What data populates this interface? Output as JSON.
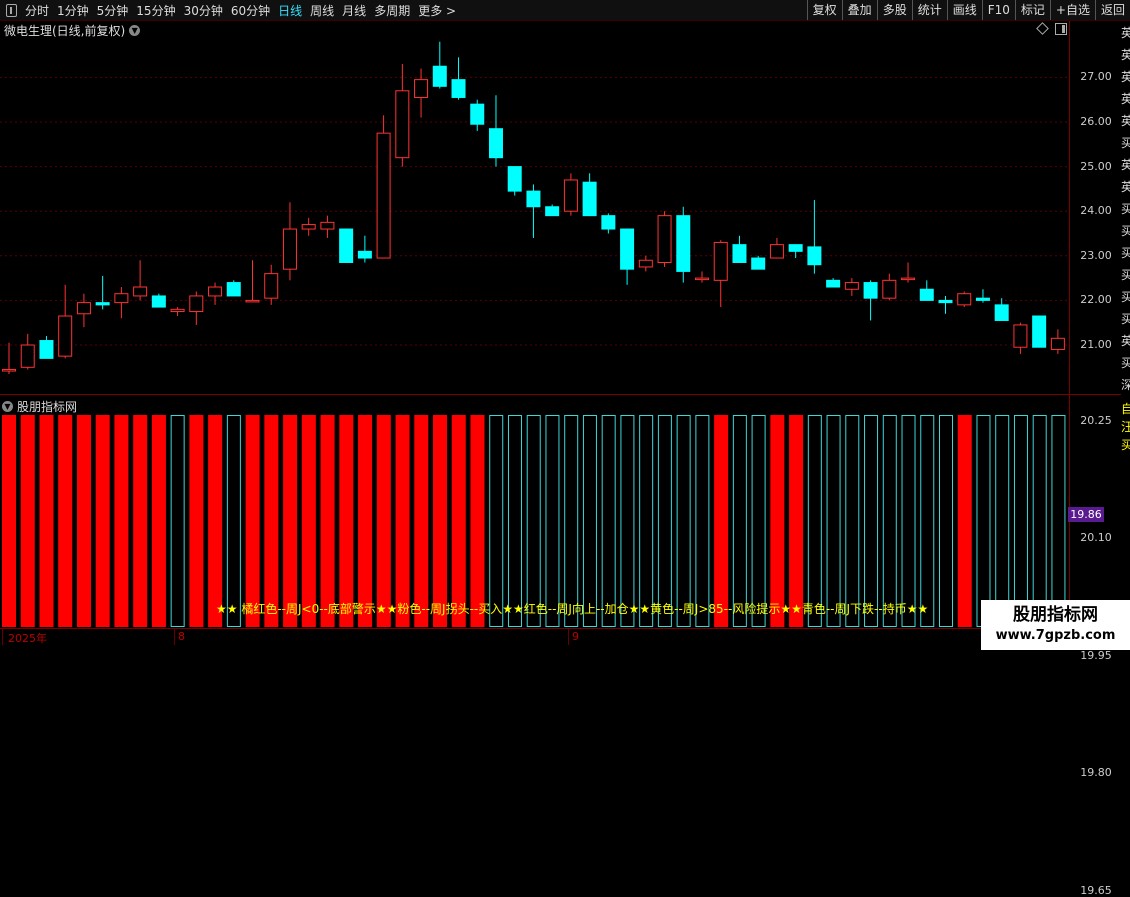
{
  "toolbar": {
    "periods": [
      "分时",
      "1分钟",
      "5分钟",
      "15分钟",
      "30分钟",
      "60分钟",
      "日线",
      "周线",
      "月线",
      "多周期",
      "更多 >"
    ],
    "active_period": "日线",
    "buttons": [
      "复权",
      "叠加",
      "多股",
      "统计",
      "画线",
      "F10",
      "标记",
      "+自选",
      "返回"
    ]
  },
  "main_chart": {
    "title": "微电生理(日线,前复权)",
    "y_ticks": [
      "27.00",
      "26.00",
      "25.00",
      "24.00",
      "23.00",
      "22.00",
      "21.00"
    ],
    "grid_line_color": "#5a0000",
    "up_color": "#ff3232",
    "down_color": "#00ffff",
    "candles": [
      {
        "o": 20.45,
        "h": 21.05,
        "l": 20.35,
        "c": 20.45
      },
      {
        "o": 20.5,
        "h": 21.25,
        "l": 20.45,
        "c": 21.0
      },
      {
        "o": 21.1,
        "h": 21.2,
        "l": 20.7,
        "c": 20.7
      },
      {
        "o": 20.75,
        "h": 22.35,
        "l": 20.7,
        "c": 21.65
      },
      {
        "o": 21.7,
        "h": 22.15,
        "l": 21.4,
        "c": 21.95
      },
      {
        "o": 21.95,
        "h": 22.55,
        "l": 21.8,
        "c": 21.9
      },
      {
        "o": 21.95,
        "h": 22.3,
        "l": 21.6,
        "c": 22.15
      },
      {
        "o": 22.1,
        "h": 22.9,
        "l": 22.0,
        "c": 22.3
      },
      {
        "o": 22.1,
        "h": 22.15,
        "l": 21.85,
        "c": 21.85
      },
      {
        "o": 21.75,
        "h": 21.85,
        "l": 21.65,
        "c": 21.8
      },
      {
        "o": 21.75,
        "h": 22.2,
        "l": 21.45,
        "c": 22.1
      },
      {
        "o": 22.1,
        "h": 22.4,
        "l": 21.9,
        "c": 22.3
      },
      {
        "o": 22.4,
        "h": 22.45,
        "l": 22.1,
        "c": 22.1
      },
      {
        "o": 22.0,
        "h": 22.9,
        "l": 22.0,
        "c": 22.0
      },
      {
        "o": 22.05,
        "h": 22.8,
        "l": 21.9,
        "c": 22.6
      },
      {
        "o": 22.7,
        "h": 24.2,
        "l": 22.45,
        "c": 23.6
      },
      {
        "o": 23.6,
        "h": 23.85,
        "l": 23.45,
        "c": 23.7
      },
      {
        "o": 23.6,
        "h": 23.9,
        "l": 23.4,
        "c": 23.75
      },
      {
        "o": 23.6,
        "h": 23.6,
        "l": 22.85,
        "c": 22.85
      },
      {
        "o": 23.1,
        "h": 23.45,
        "l": 22.85,
        "c": 22.95
      },
      {
        "o": 22.95,
        "h": 26.15,
        "l": 22.95,
        "c": 25.75
      },
      {
        "o": 25.2,
        "h": 27.3,
        "l": 25.0,
        "c": 26.7
      },
      {
        "o": 26.55,
        "h": 27.2,
        "l": 26.1,
        "c": 26.95
      },
      {
        "o": 27.25,
        "h": 27.8,
        "l": 26.75,
        "c": 26.8
      },
      {
        "o": 26.95,
        "h": 27.45,
        "l": 26.5,
        "c": 26.55
      },
      {
        "o": 26.4,
        "h": 26.5,
        "l": 25.8,
        "c": 25.95
      },
      {
        "o": 25.85,
        "h": 26.6,
        "l": 25.0,
        "c": 25.2
      },
      {
        "o": 25.0,
        "h": 25.0,
        "l": 24.35,
        "c": 24.45
      },
      {
        "o": 24.45,
        "h": 24.6,
        "l": 23.4,
        "c": 24.1
      },
      {
        "o": 24.1,
        "h": 24.15,
        "l": 23.9,
        "c": 23.9
      },
      {
        "o": 24.0,
        "h": 24.85,
        "l": 23.9,
        "c": 24.7
      },
      {
        "o": 24.65,
        "h": 24.85,
        "l": 23.9,
        "c": 23.9
      },
      {
        "o": 23.9,
        "h": 23.95,
        "l": 23.5,
        "c": 23.6
      },
      {
        "o": 23.6,
        "h": 23.6,
        "l": 22.35,
        "c": 22.7
      },
      {
        "o": 22.75,
        "h": 23.0,
        "l": 22.65,
        "c": 22.9
      },
      {
        "o": 22.85,
        "h": 24.0,
        "l": 22.75,
        "c": 23.9
      },
      {
        "o": 23.9,
        "h": 24.1,
        "l": 22.4,
        "c": 22.65
      },
      {
        "o": 22.5,
        "h": 22.65,
        "l": 22.4,
        "c": 22.5
      },
      {
        "o": 22.45,
        "h": 23.35,
        "l": 21.85,
        "c": 23.3
      },
      {
        "o": 23.25,
        "h": 23.45,
        "l": 22.85,
        "c": 22.85
      },
      {
        "o": 22.95,
        "h": 23.0,
        "l": 22.7,
        "c": 22.7
      },
      {
        "o": 22.95,
        "h": 23.4,
        "l": 22.95,
        "c": 23.25
      },
      {
        "o": 23.25,
        "h": 23.25,
        "l": 22.95,
        "c": 23.1
      },
      {
        "o": 23.2,
        "h": 24.25,
        "l": 22.6,
        "c": 22.8
      },
      {
        "o": 22.45,
        "h": 22.5,
        "l": 22.3,
        "c": 22.3
      },
      {
        "o": 22.25,
        "h": 22.5,
        "l": 22.1,
        "c": 22.4
      },
      {
        "o": 22.4,
        "h": 22.45,
        "l": 21.55,
        "c": 22.05
      },
      {
        "o": 22.05,
        "h": 22.6,
        "l": 22.0,
        "c": 22.45
      },
      {
        "o": 22.5,
        "h": 22.85,
        "l": 22.4,
        "c": 22.5
      },
      {
        "o": 22.25,
        "h": 22.45,
        "l": 22.0,
        "c": 22.0
      },
      {
        "o": 22.0,
        "h": 22.1,
        "l": 21.7,
        "c": 21.95
      },
      {
        "o": 21.9,
        "h": 22.2,
        "l": 21.85,
        "c": 22.15
      },
      {
        "o": 22.05,
        "h": 22.25,
        "l": 21.95,
        "c": 22.0
      },
      {
        "o": 21.9,
        "h": 22.05,
        "l": 21.55,
        "c": 21.55
      },
      {
        "o": 20.95,
        "h": 21.5,
        "l": 20.8,
        "c": 21.45
      },
      {
        "o": 21.65,
        "h": 21.65,
        "l": 20.95,
        "c": 20.95
      },
      {
        "o": 20.9,
        "h": 21.35,
        "l": 20.8,
        "c": 21.15
      }
    ]
  },
  "sub_chart": {
    "title": "股朋指标网",
    "y_ticks": [
      "20.25",
      "20.10",
      "19.95",
      "19.80",
      "19.65"
    ],
    "current_value": "19.86",
    "bars": [
      "R",
      "R",
      "R",
      "R",
      "R",
      "R",
      "R",
      "R",
      "R",
      "C",
      "R",
      "R",
      "C",
      "R",
      "R",
      "R",
      "R",
      "R",
      "R",
      "R",
      "R",
      "R",
      "R",
      "R",
      "R",
      "R",
      "C",
      "C",
      "C",
      "C",
      "C",
      "C",
      "C",
      "C",
      "C",
      "C",
      "C",
      "C",
      "R",
      "C",
      "C",
      "R",
      "R",
      "C",
      "C",
      "C",
      "C",
      "C",
      "C",
      "C",
      "C",
      "R",
      "C",
      "C",
      "C",
      "C",
      "C"
    ],
    "legend_text": "★★ 橘红色--周J<0--底部警示★★粉色--周J拐头--买入★★红色--周J向上--加仓★★黄色--周J>85--风险提示★★青色--周J下跌--持币★★"
  },
  "time_axis": {
    "labels": [
      "2025年",
      "8",
      "9"
    ]
  },
  "right_edge": {
    "text_top": "英英英英英买英英买买买买买买英买深买深买买买买买买",
    "text_bottom": "自汪买"
  },
  "watermark": {
    "title": "股朋指标网",
    "url": "www.7gpzb.com"
  }
}
